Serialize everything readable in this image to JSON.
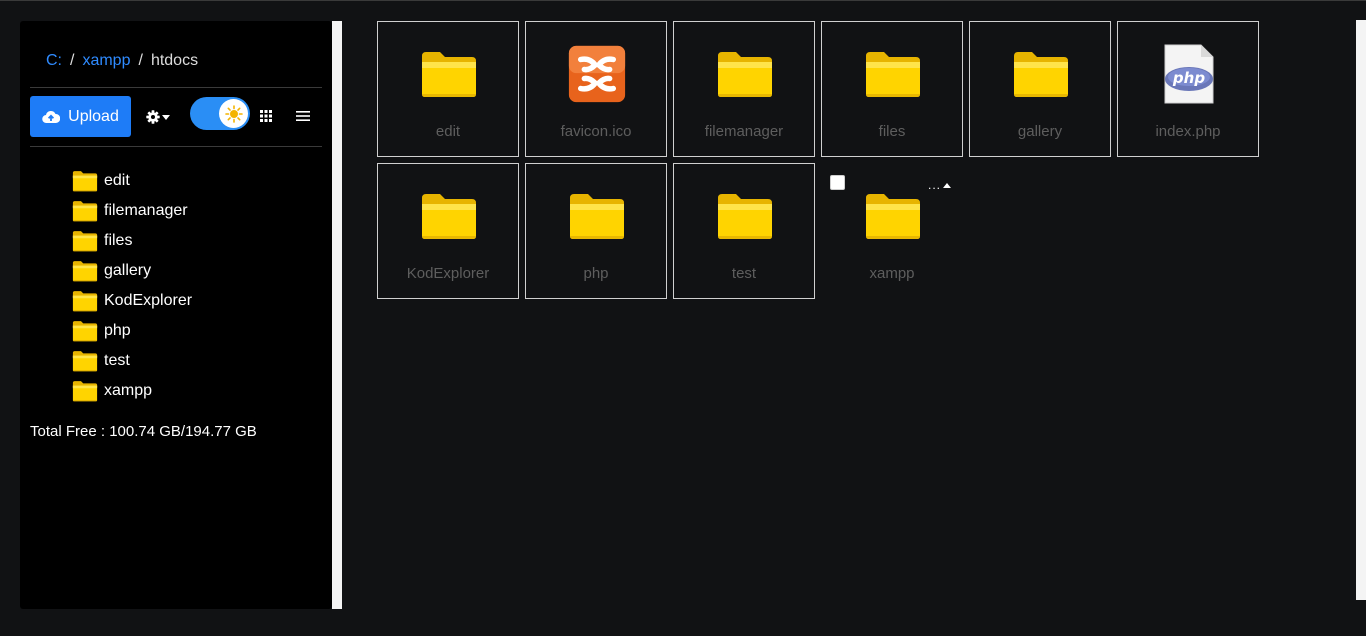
{
  "breadcrumb": {
    "drive": "C:",
    "folder": "xampp",
    "current": "htdocs",
    "separator": "/"
  },
  "toolbar": {
    "upload_label": "Upload"
  },
  "tree": [
    "edit",
    "filemanager",
    "files",
    "gallery",
    "KodExplorer",
    "php",
    "test",
    "xampp"
  ],
  "storage": {
    "text": "Total Free : 100.74 GB/194.77 GB"
  },
  "files": [
    {
      "name": "edit",
      "type": "folder"
    },
    {
      "name": "favicon.ico",
      "type": "xampp-icon"
    },
    {
      "name": "filemanager",
      "type": "folder"
    },
    {
      "name": "files",
      "type": "folder"
    },
    {
      "name": "gallery",
      "type": "folder"
    },
    {
      "name": "index.php",
      "type": "php-file"
    },
    {
      "name": "KodExplorer",
      "type": "folder"
    },
    {
      "name": "php",
      "type": "folder"
    },
    {
      "name": "test",
      "type": "folder"
    },
    {
      "name": "xampp",
      "type": "folder"
    }
  ],
  "hover_menu": {
    "label": "..."
  },
  "colors": {
    "accent": "#1e7cf7",
    "folder": "#ffd400",
    "sidebar_bg": "#000000",
    "main_bg": "#111214"
  }
}
